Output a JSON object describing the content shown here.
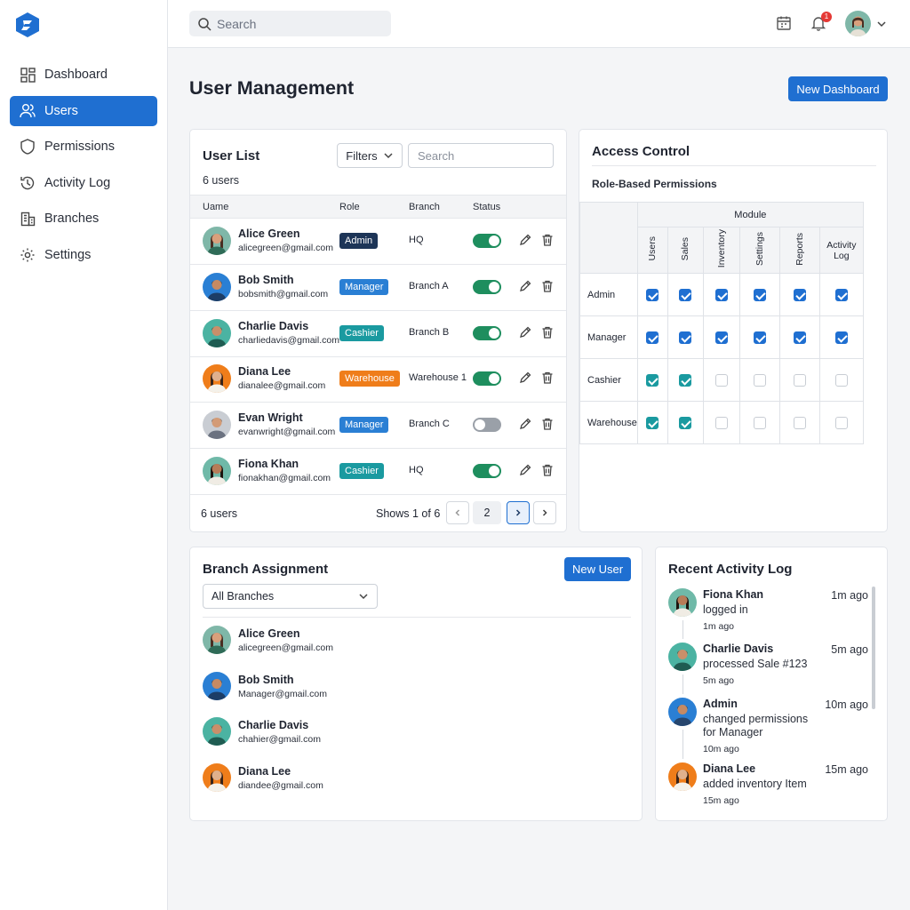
{
  "colors": {
    "accent": "#1f6fd1",
    "admin": "#1d3557",
    "manager": "#2a7fd4",
    "cashier": "#1a9aa0",
    "warehouse": "#ef7d1a",
    "toggle_on": "#1e8e5e",
    "toggle_off": "#9aa0a8"
  },
  "sidebar": {
    "logo_icon": "brand-logo",
    "items": [
      {
        "label": "Dashboard",
        "icon": "dashboard-icon"
      },
      {
        "label": "Users",
        "icon": "users-icon"
      },
      {
        "label": "Permissions",
        "icon": "shield-icon"
      },
      {
        "label": "Activity Log",
        "icon": "history-icon"
      },
      {
        "label": "Branches",
        "icon": "building-icon"
      },
      {
        "label": "Settings",
        "icon": "gear-icon"
      }
    ]
  },
  "topbar": {
    "search_placeholder": "Search",
    "notification_count": "1"
  },
  "page": {
    "title": "User Management",
    "new_dashboard_label": "New Dashboard"
  },
  "user_list": {
    "title": "User List",
    "count_label": "6 users",
    "filters_label": "Filters",
    "search_placeholder": "Search",
    "columns": [
      "Uame",
      "Role",
      "Branch",
      "Status"
    ],
    "rows": [
      {
        "name": "Alice Green",
        "email": "alicegreen@gmail.com",
        "role": "Admin",
        "branch": "HQ",
        "active": true
      },
      {
        "name": "Bob Smith",
        "email": "bobsmith@gmail.com",
        "role": "Manager",
        "branch": "Branch A",
        "active": true
      },
      {
        "name": "Charlie Davis",
        "email": "charliedavis@gmail.com",
        "role": "Cashier",
        "branch": "Branch B",
        "active": true
      },
      {
        "name": "Diana Lee",
        "email": "dianalee@gmail.com",
        "role": "Warehouse",
        "branch": "Warehouse 1",
        "active": true
      },
      {
        "name": "Evan Wright",
        "email": "evanwright@gmail.com",
        "role": "Manager",
        "branch": "Branch C",
        "active": false
      },
      {
        "name": "Fiona Khan",
        "email": "fionakhan@gmail.com",
        "role": "Cashier",
        "branch": "HQ",
        "active": true
      }
    ],
    "footer_count": "6 users",
    "shows_label": "Shows 1 of 6",
    "page_number": "2",
    "prev_icon": "chevron-left-icon",
    "next_icon": "chevron-right-icon"
  },
  "access_control": {
    "title": "Access Control",
    "subtitle": "Role-Based Permissions",
    "module_label": "Module",
    "modules": [
      "Users",
      "Sales",
      "Inventory",
      "Settings",
      "Reports",
      "Activity Log"
    ],
    "roles": [
      {
        "name": "Admin",
        "perms": [
          "on",
          "on",
          "on",
          "on",
          "on",
          "on"
        ]
      },
      {
        "name": "Manager",
        "perms": [
          "on",
          "on",
          "on",
          "on",
          "on",
          "on"
        ]
      },
      {
        "name": "Cashier",
        "perms": [
          "teal",
          "teal",
          "off",
          "off",
          "off",
          "off"
        ]
      },
      {
        "name": "Warehouse",
        "perms": [
          "teal",
          "teal",
          "off",
          "off",
          "off",
          "off"
        ]
      }
    ]
  },
  "branch_assignment": {
    "title": "Branch Assignment",
    "new_user_label": "New User",
    "select_value": "All Branches",
    "items": [
      {
        "name": "Alice Green",
        "email": "alicegreen@gmail.com"
      },
      {
        "name": "Bob Smith",
        "email": "Manager@gmail.com"
      },
      {
        "name": "Charlie Davis",
        "email": "chahier@gmail.com"
      },
      {
        "name": "Diana Lee",
        "email": "diandee@gmail.com"
      }
    ]
  },
  "activity_log": {
    "title": "Recent Activity Log",
    "items": [
      {
        "who": "Fiona Khan",
        "what": "logged in",
        "ago": "1m ago",
        "time": "1m ago"
      },
      {
        "who": "Charlie Davis",
        "what": "processed Sale #123",
        "ago": "5m ago",
        "time": "5m ago"
      },
      {
        "who": "Admin",
        "what": "changed permissions for Manager",
        "ago": "10m ago",
        "time": "10m ago"
      },
      {
        "who": "Diana Lee",
        "what": "added inventory Item",
        "ago": "15m ago",
        "time": "15m ago"
      }
    ]
  }
}
